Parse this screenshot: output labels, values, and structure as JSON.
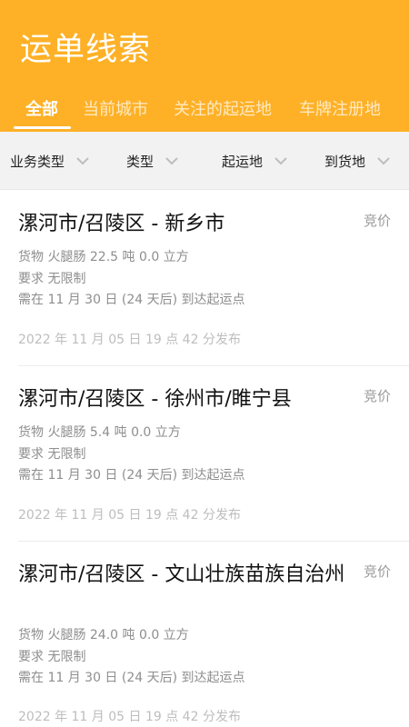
{
  "header": {
    "title": "运单线索",
    "tabs": [
      "全部",
      "当前城市",
      "关注的起运地",
      "车牌注册地"
    ]
  },
  "filters": [
    "业务类型",
    "类型",
    "起运地",
    "到货地"
  ],
  "orders": [
    {
      "route": "漯河市/召陵区 - 新乡市",
      "price": "竞价",
      "cargo": "货物 火腿肠 22.5 吨 0.0 立方",
      "requirement": "要求 无限制",
      "deadline": "需在 11 月 30 日 (24 天后) 到达起运点",
      "published": "2022 年 11 月 05 日 19 点 42 分发布"
    },
    {
      "route": "漯河市/召陵区 - 徐州市/睢宁县",
      "price": "竞价",
      "cargo": "货物 火腿肠 5.4 吨 0.0 立方",
      "requirement": "要求 无限制",
      "deadline": "需在 11 月 30 日 (24 天后) 到达起运点",
      "published": "2022 年 11 月 05 日 19 点 42 分发布"
    },
    {
      "route": "漯河市/召陵区 - 文山壮族苗族自治州",
      "price": "竞价",
      "cargo": "货物 火腿肠 24.0 吨 0.0 立方",
      "requirement": "要求 无限制",
      "deadline": "需在 11 月 30 日 (24 天后) 到达起运点",
      "published": "2022 年 11 月 05 日 19 点 42 分发布"
    }
  ],
  "colors": {
    "accent": "#FEB127",
    "filter_bg": "#F2F2F2",
    "muted_text": "#8E8E8E"
  },
  "icons": {
    "filter_dropdown": "chevron-down-icon"
  }
}
